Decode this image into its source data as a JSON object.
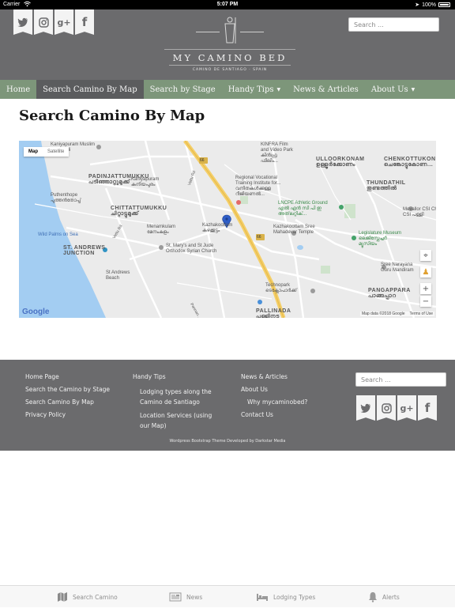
{
  "status_bar": {
    "carrier": "Carrier",
    "time": "5:07 PM",
    "battery": "100%"
  },
  "header": {
    "brand": "MY CAMINO BED",
    "tagline": "CAMINO DE SANTIAGO · SPAIN",
    "search_placeholder": "Search ...",
    "social_icons": [
      "twitter-icon",
      "instagram-icon",
      "google-plus-icon",
      "facebook-icon"
    ]
  },
  "nav": {
    "items": [
      {
        "label": "Home"
      },
      {
        "label": "Search Camino By Map"
      },
      {
        "label": "Search by Stage"
      },
      {
        "label": "Handy Tips"
      },
      {
        "label": "News & Articles"
      },
      {
        "label": "About Us"
      }
    ],
    "active": "Search Camino By Map"
  },
  "page": {
    "title": "Search Camino By Map"
  },
  "map": {
    "type_map": "Map",
    "type_satellite": "Satellite",
    "zoom_in": "+",
    "zoom_out": "−",
    "logo": "Google",
    "attribution": "Map data ©2018 Google",
    "terms": "Terms of Use",
    "labels": {
      "muslim": "Kaniyapuram Muslim\nValyapalli",
      "kaniyapuram": "Kaniyapuram\nകനിയപുരം",
      "kinfra": "KINFRA Film\nand Video Park\nകിൻഫ്ര\nഫിലിം...",
      "ulloorkonam": "ULLOORKONAM\nഉള്ളൂർക്കോണം",
      "chenkottukonam": "CHENKOTTUKON...\nചെങ്കോട്ടുകോണ...",
      "padinjattumukku": "PADINJATTUMUKKU\nപടിഞ്ഞാറ്റുമുക്ക്",
      "vocational": "Regional Vocational\nTraining Institute for...\nവനിതകൾക്കുള്ള\nറീജിയണൽ...",
      "thundathil": "THUNDATHIL\nതുണ്ടത്തിൽ",
      "puthenthope": "Puthenthope\nപുത്തൻതോപ്പ്",
      "chittattumukku": "CHITTATTUMUKKU\nചിറ്റാട്ടുമുക്ക്",
      "lncpe": "LNCPE Athletic Ground\nഎൽ എൻ സി പി ഇ\nഅത്‌ലറ്റിക്...",
      "mevallor": "Mevallor CSI Chu...\nCSI പള്ളി",
      "wildpalms": "Wild Palms on Sea",
      "menamkulam": "Menamkulam\nമേനംകുളം",
      "kazhakoottam": "Kazhakoottam\nകഴക്കൂട്ടം",
      "kazhakoottam_temple": "Kazhakoottam Sree\nMahadevar Temple",
      "legislature": "Legislature Museum\nലെജിസ്ലേച്ചർ\nമ്യൂസിയം",
      "standrews_junction": "ST. ANDREWS\nJUNCTION",
      "stmarys": "St. Mary's and St Jude\nOrthodox Syrian Church",
      "standrews_beach": "St Andrews\nBeach",
      "sreenarayana": "Sree Narayana\nGuru Mandiram",
      "technopark": "Technopark\nടെക്നോപാർക്ക്",
      "pangappara": "PANGAPPARA\nപാങ്ങപ്പാറ",
      "pallinada": "PALLINADA\nപള്ളിനട",
      "road66a": "66",
      "road66b": "66",
      "vettu": "Vettu Rd",
      "vettu2": "Vettu Rd",
      "pannan": "Pannan..."
    }
  },
  "footer": {
    "col1": [
      "Home Page",
      "Search the Camino by Stage",
      "Search Camino By Map",
      "Privacy Policy"
    ],
    "col2_title": "Handy Tips",
    "col2_items": [
      "Lodging types along the Camino de Santiago",
      "Location Services (using our Map)"
    ],
    "col3": [
      "News & Articles",
      "About Us"
    ],
    "col3_sub": "Why mycaminobed?",
    "col3_last": "Contact Us",
    "search_placeholder": "Search ...",
    "credit": "Wordpress Bootstrap Theme Developed by Darkstar Media"
  },
  "tabbar": {
    "items": [
      {
        "label": "Search Camino",
        "icon": "map-icon",
        "active": true
      },
      {
        "label": "News",
        "icon": "newspaper-icon"
      },
      {
        "label": "Lodging Types",
        "icon": "bed-icon"
      },
      {
        "label": "Alerts",
        "icon": "bell-icon"
      }
    ]
  },
  "colors": {
    "header_bg": "#6b6b6d",
    "nav_bg": "#7d967a",
    "nav_active": "#5b5c5e",
    "sea": "#9ecbf0",
    "map_land": "#e8e8e8"
  }
}
